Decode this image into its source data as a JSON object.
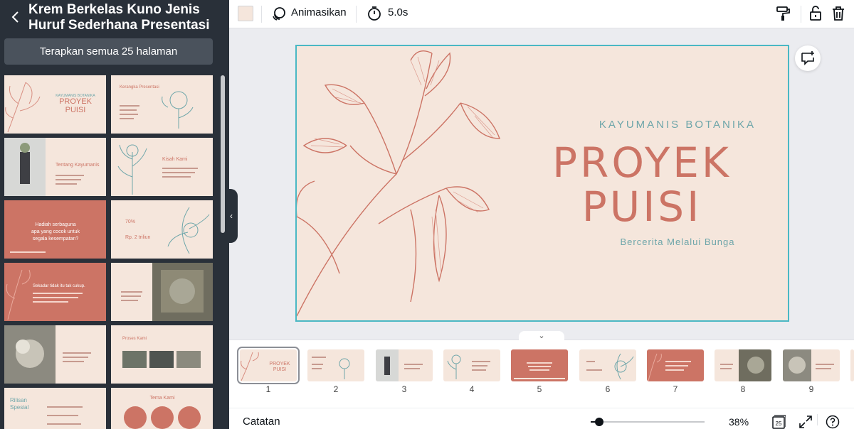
{
  "template_panel": {
    "title": "Krem Berkelas Kuno Jenis Huruf Sederhana Presentasi",
    "apply_label": "Terapkan semua 25 halaman"
  },
  "template_thumbs": [
    {
      "bg": "#f5e6dc",
      "text": "PROYEK PUISI",
      "accent": "#cc7465"
    },
    {
      "bg": "#f5e6dc",
      "text": "Kerangka Presentasi",
      "accent": "#cc7465"
    },
    {
      "bg": "#f5e6dc",
      "text": "Tentang Kayumanis",
      "accent": "#cc7465"
    },
    {
      "bg": "#f5e6dc",
      "text": "Kisah Kami",
      "accent": "#cc7465"
    },
    {
      "bg": "#cc7465",
      "text": "Hadiah serbaguna apa yang cocok untuk segala kesempatan?",
      "accent": "#ffffff"
    },
    {
      "bg": "#f5e6dc",
      "text": "70% Rp. 2 triliun",
      "accent": "#cc7465"
    },
    {
      "bg": "#cc7465",
      "text": "Sekadar tidak itu tak cukup.",
      "accent": "#ffffff"
    },
    {
      "bg": "#f5e6dc",
      "text": "",
      "accent": "#cc7465"
    },
    {
      "bg": "#f5e6dc",
      "text": "",
      "accent": "#cc7465"
    },
    {
      "bg": "#f5e6dc",
      "text": "Proses Kami",
      "accent": "#cc7465"
    },
    {
      "bg": "#f5e6dc",
      "text": "Rilisan Spesial",
      "accent": "#6ea6aa"
    },
    {
      "bg": "#f5e6dc",
      "text": "Tema Kami",
      "accent": "#cc7465"
    }
  ],
  "toolbar": {
    "color": "#f5e6dc",
    "animate_label": "Animasikan",
    "duration": "5.0s"
  },
  "slide": {
    "kicker": "KAYUMANIS BOTANIKA",
    "title_line1": "PROYEK",
    "title_line2": "PUISI",
    "subtitle": "Bercerita Melalui Bunga"
  },
  "pages": [
    {
      "num": "1",
      "bg": "#f5e6dc",
      "text": "PROYEK PUISI"
    },
    {
      "num": "2",
      "bg": "#f5e6dc",
      "text": "Kerangka Presentasi"
    },
    {
      "num": "3",
      "bg": "#f5e6dc",
      "text": "Tentang Kayumanis"
    },
    {
      "num": "4",
      "bg": "#f5e6dc",
      "text": "Kisah Kami"
    },
    {
      "num": "5",
      "bg": "#cc7465",
      "text": ""
    },
    {
      "num": "6",
      "bg": "#f5e6dc",
      "text": "70%"
    },
    {
      "num": "7",
      "bg": "#cc7465",
      "text": ""
    },
    {
      "num": "8",
      "bg": "#f5e6dc",
      "text": ""
    },
    {
      "num": "9",
      "bg": "#f5e6dc",
      "text": ""
    }
  ],
  "footer": {
    "notes_label": "Catatan",
    "zoom": "38%",
    "page_count": "25"
  }
}
